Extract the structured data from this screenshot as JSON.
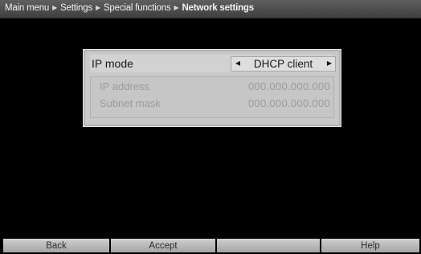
{
  "breadcrumb": {
    "items": [
      "Main menu",
      "Settings",
      "Special functions"
    ],
    "current": "Network settings",
    "separator_icon": "triangle-right-icon"
  },
  "dialog": {
    "ip_mode": {
      "label": "IP mode",
      "value": "DHCP client",
      "left_arrow_icon": "arrow-left-icon",
      "right_arrow_icon": "arrow-right-icon"
    },
    "ip_address": {
      "label": "IP address",
      "value": "000.000.000.000",
      "disabled": true
    },
    "subnet_mask": {
      "label": "Subnet mask",
      "value": "000.000.000.000",
      "disabled": true
    }
  },
  "softkeys": {
    "back": "Back",
    "accept": "Accept",
    "empty": "",
    "help": "Help"
  },
  "colors": {
    "background": "#000000",
    "panel": "#c8c8c8",
    "disabled_text": "#9b9b9b",
    "topbar": "#4f4f4f"
  }
}
